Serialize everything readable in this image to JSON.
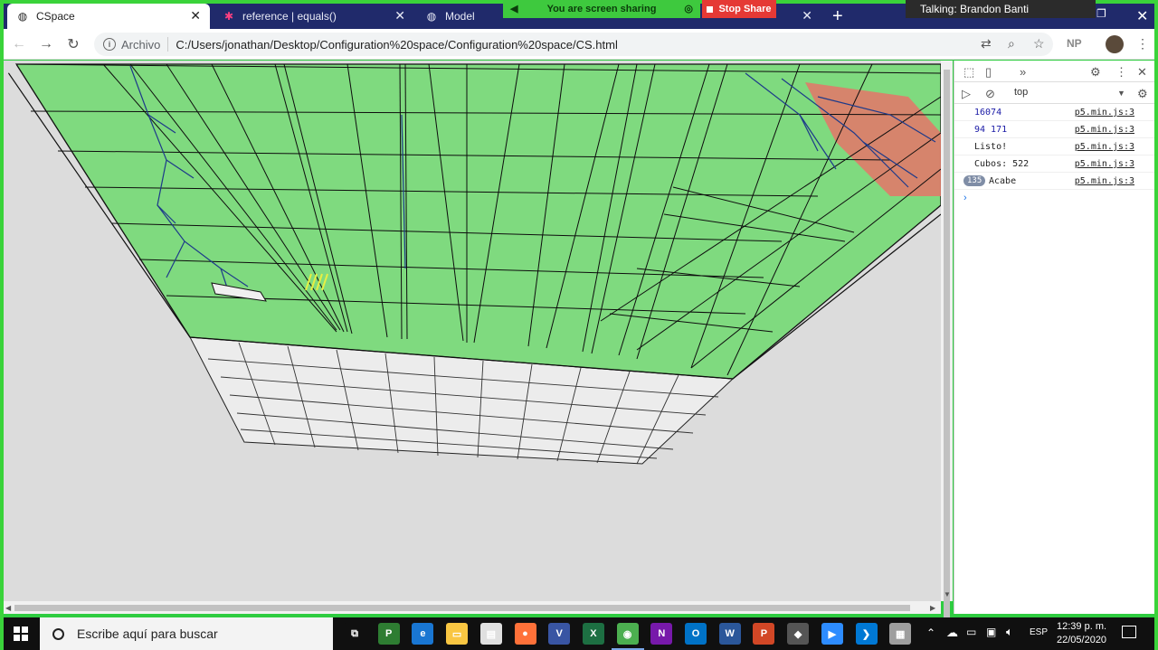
{
  "browser": {
    "tabs": [
      {
        "label": "CSpace",
        "icon": "globe-icon",
        "active": true
      },
      {
        "label": "reference | equals()",
        "icon": "star-icon",
        "active": false
      },
      {
        "label": "Model",
        "icon": "globe-icon",
        "active": false
      }
    ],
    "close_glyph": "✕",
    "new_tab_glyph": "+",
    "screen_sharing_label": "You are screen sharing",
    "stop_share_label": "Stop Share",
    "talking_label": "Talking: Brandon Banti",
    "address_scheme": "Archivo",
    "address_url": "C:/Users/jonathan/Desktop/Configuration%20space/Configuration%20space/CS.html",
    "profile_initials": "NP"
  },
  "devtools": {
    "context": "top",
    "console_rows": [
      {
        "message": "16074",
        "source": "p5.min.js:3",
        "type": "number",
        "count": ""
      },
      {
        "message": "94 171",
        "source": "p5.min.js:3",
        "type": "number",
        "count": ""
      },
      {
        "message": "Listo!",
        "source": "p5.min.js:3",
        "type": "text",
        "count": ""
      },
      {
        "message": "Cubos: 522",
        "source": "p5.min.js:3",
        "type": "text",
        "count": ""
      },
      {
        "message": "Acabe",
        "source": "p5.min.js:3",
        "type": "text",
        "count": "135"
      }
    ],
    "prompt_glyph": "›"
  },
  "taskbar": {
    "search_placeholder": "Escribe aquí para buscar",
    "language": "ESP",
    "time": "12:39 p. m.",
    "date": "22/05/2020",
    "apps": [
      {
        "name": "task-view-icon",
        "color": "#101010",
        "glyph": "⧉"
      },
      {
        "name": "project-icon",
        "color": "#2e7d32",
        "glyph": "P"
      },
      {
        "name": "edge-icon",
        "color": "#1976d2",
        "glyph": "e"
      },
      {
        "name": "file-explorer-icon",
        "color": "#f9c642",
        "glyph": "▭"
      },
      {
        "name": "store-icon",
        "color": "#e0e0e0",
        "glyph": "▤"
      },
      {
        "name": "firefox-icon",
        "color": "#ff7139",
        "glyph": "●"
      },
      {
        "name": "visio-icon",
        "color": "#3955a3",
        "glyph": "V"
      },
      {
        "name": "excel-icon",
        "color": "#1d6f42",
        "glyph": "X"
      },
      {
        "name": "chrome-icon",
        "color": "#4caf50",
        "glyph": "◉"
      },
      {
        "name": "onenote-icon",
        "color": "#7719aa",
        "glyph": "N"
      },
      {
        "name": "outlook-icon",
        "color": "#0072c6",
        "glyph": "O"
      },
      {
        "name": "word-icon",
        "color": "#2b579a",
        "glyph": "W"
      },
      {
        "name": "powerpoint-icon",
        "color": "#d24726",
        "glyph": "P"
      },
      {
        "name": "inkscape-icon",
        "color": "#555555",
        "glyph": "◆"
      },
      {
        "name": "zoom-icon",
        "color": "#2d8cff",
        "glyph": "▶"
      },
      {
        "name": "vscode-icon",
        "color": "#0078d4",
        "glyph": "❯"
      },
      {
        "name": "app-icon",
        "color": "#9e9e9e",
        "glyph": "▦"
      }
    ]
  },
  "colors": {
    "mesh_green": "#6fd96f",
    "mesh_red": "#e07a6a",
    "share_green": "#3ec93e",
    "stop_red": "#e53935"
  }
}
